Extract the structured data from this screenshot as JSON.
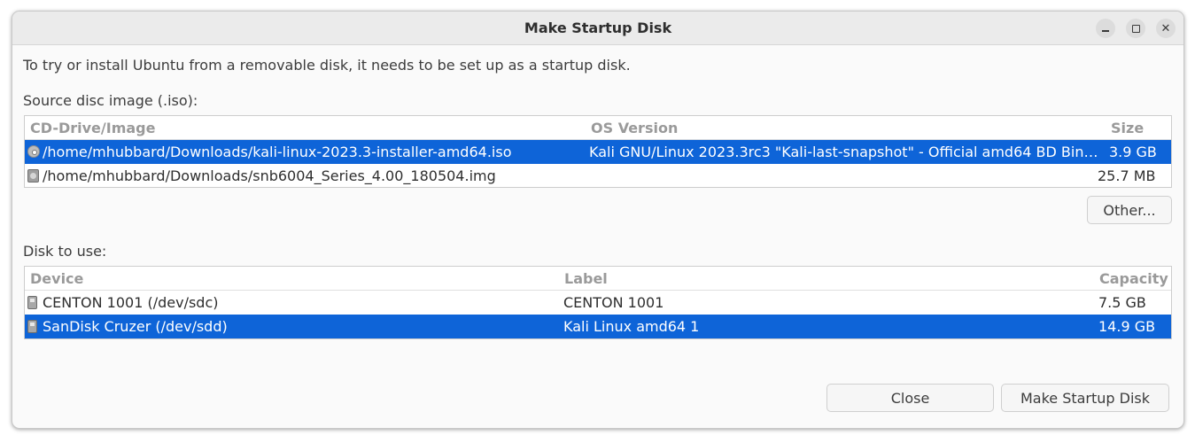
{
  "window": {
    "title": "Make Startup Disk"
  },
  "intro_text": "To try or install Ubuntu from a removable disk, it needs to be set up as a startup disk.",
  "source": {
    "label": "Source disc image (.iso):",
    "columns": {
      "image": "CD-Drive/Image",
      "os_version": "OS Version",
      "size": "Size"
    },
    "rows": [
      {
        "icon": "disc-icon",
        "image": "/home/mhubbard/Downloads/kali-linux-2023.3-installer-amd64.iso",
        "os_version": "Kali GNU/Linux 2023.3rc3 \"Kali-last-snapshot\" - Official amd64 BD Bin…",
        "size": "3.9 GB",
        "selected": true
      },
      {
        "icon": "disk-image-icon",
        "image": "/home/mhubbard/Downloads/snb6004_Series_4.00_180504.img",
        "os_version": "",
        "size": "25.7 MB",
        "selected": false
      }
    ],
    "other_button": "Other..."
  },
  "disk": {
    "label": "Disk to use:",
    "columns": {
      "device": "Device",
      "label": "Label",
      "capacity": "Capacity"
    },
    "rows": [
      {
        "icon": "usb-drive-icon",
        "device": "CENTON 1001 (/dev/sdc)",
        "label": "CENTON 1001",
        "capacity": "7.5 GB",
        "selected": false
      },
      {
        "icon": "usb-drive-icon",
        "device": "SanDisk Cruzer (/dev/sdd)",
        "label": "Kali Linux amd64 1",
        "capacity": "14.9 GB",
        "selected": true
      }
    ]
  },
  "buttons": {
    "close": "Close",
    "make": "Make Startup Disk"
  },
  "colors": {
    "selection": "#0e64d8"
  }
}
